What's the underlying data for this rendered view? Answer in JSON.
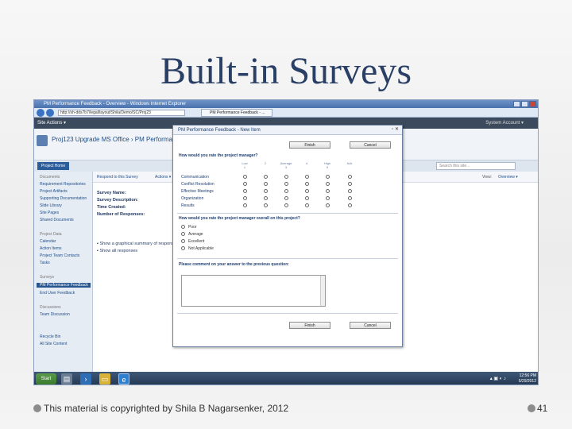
{
  "slide": {
    "title": "Built-in Surveys",
    "footer": "This material is copyrighted by Shila B Nagarsenker, 2012",
    "page_number": "41"
  },
  "browser": {
    "title": "PM Performance Feedback - Overview - Windows Internet Explorer",
    "address": "http://sh-dds7b7/legal/layout/Shila/Demo/SC/Proj23",
    "tab_label": "PM Performance Feedback - ..."
  },
  "sharepoint": {
    "site_actions": "Site Actions ▾",
    "user_menu": "System Account ▾",
    "site_title": "Proj123 Upgrade MS Office › PM Performance Feedback",
    "home_tab": "Project Home",
    "search_placeholder": "Search this site...",
    "view_label": "View:",
    "view_value": "Overview ▾",
    "toolbar": {
      "respond": "Respond to this Survey",
      "actions": "Actions ▾"
    },
    "quick_launch": [
      {
        "label": "Documents",
        "type": "header"
      },
      {
        "label": "Requirement Repositories",
        "type": "item"
      },
      {
        "label": "Project Artifacts",
        "type": "item"
      },
      {
        "label": "Supporting Documentation",
        "type": "item"
      },
      {
        "label": "Slide Library",
        "type": "item"
      },
      {
        "label": "Site Pages",
        "type": "item"
      },
      {
        "label": "Shared Documents",
        "type": "item"
      },
      {
        "label": "Project Data",
        "type": "header"
      },
      {
        "label": "Calendar",
        "type": "item"
      },
      {
        "label": "Action Items",
        "type": "item"
      },
      {
        "label": "Project Team Contacts",
        "type": "item"
      },
      {
        "label": "Tasks",
        "type": "item"
      },
      {
        "label": "Surveys",
        "type": "header"
      },
      {
        "label": "PM Performance Feedback",
        "type": "selected"
      },
      {
        "label": "End User Feedback",
        "type": "item"
      },
      {
        "label": "Discussions",
        "type": "header"
      },
      {
        "label": "Team Discussion",
        "type": "item"
      },
      {
        "label": "Recycle Bin",
        "type": "item"
      },
      {
        "label": "All Site Content",
        "type": "item"
      }
    ],
    "survey_info": [
      {
        "label": "Survey Name:"
      },
      {
        "label": "Survey Description:"
      },
      {
        "label": "Time Created:"
      },
      {
        "label": "Number of Responses:"
      }
    ],
    "view_options": [
      "Show a graphical summary of responses",
      "Show all responses"
    ]
  },
  "dialog": {
    "title": "PM Performance Feedback - New Item",
    "finish_label": "Finish",
    "cancel_label": "Cancel",
    "q1": "How would you rate the project manager?",
    "scale": [
      {
        "num": "1",
        "top": "Low"
      },
      {
        "num": "2",
        "top": ""
      },
      {
        "num": "3",
        "top": "Average"
      },
      {
        "num": "4",
        "top": ""
      },
      {
        "num": "5",
        "top": "High"
      },
      {
        "num": "N/A",
        "top": ""
      }
    ],
    "criteria": [
      "Communication",
      "Conflict Resolution",
      "Effective Meetings",
      "Organization",
      "Results"
    ],
    "q2": "How would you rate the project manager overall on this project?",
    "options": [
      "Poor",
      "Average",
      "Excellent",
      "Not Applicable"
    ],
    "q3": "Please comment on your answer to the previous question:"
  },
  "taskbar": {
    "start": "Start",
    "time": "12:56 PM",
    "date": "5/29/2012"
  }
}
